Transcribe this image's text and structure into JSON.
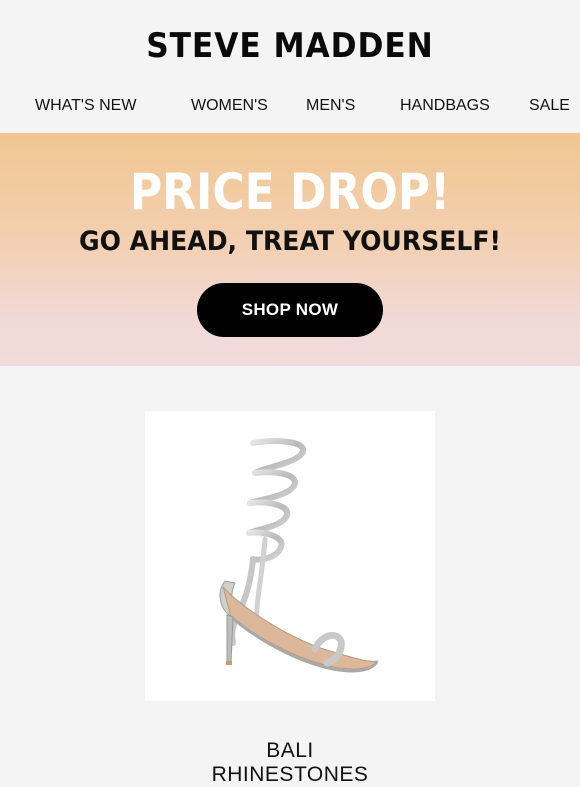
{
  "brand": {
    "logo_text": "STEVE MADDEN"
  },
  "nav": {
    "items": [
      {
        "label": "WHAT'S NEW"
      },
      {
        "label": "WOMEN'S"
      },
      {
        "label": "MEN'S"
      },
      {
        "label": "HANDBAGS"
      },
      {
        "label": "SALE"
      }
    ]
  },
  "banner": {
    "title": "PRICE DROP!",
    "subtitle": "GO AHEAD, TREAT YOURSELF!",
    "cta_label": "SHOP NOW",
    "gradient_top": "#f1c690",
    "gradient_bottom": "#f2dbdc"
  },
  "product": {
    "image_icon": "strappy-heel-sandal-image",
    "name_line1": "BALI",
    "name_line2": "RHINESTONES"
  },
  "colors": {
    "background": "#f4f4f4",
    "button": "#000000",
    "text": "#111111"
  }
}
